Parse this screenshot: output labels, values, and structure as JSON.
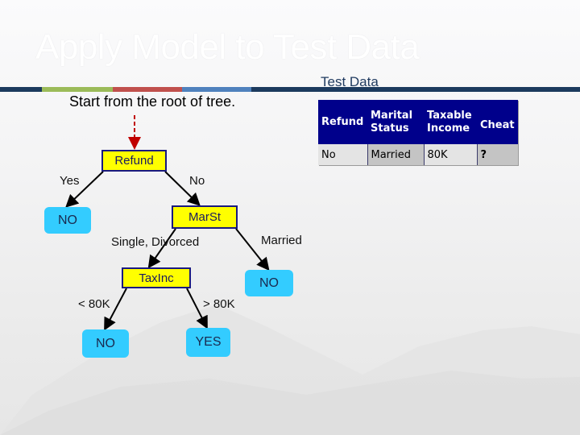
{
  "slide": {
    "title": "Apply Model to Test Data",
    "subtitle": "Start from the root of tree.",
    "accent_band_colors": [
      "#1c3a5e",
      "#9bbb59",
      "#c0504d",
      "#4f81bd",
      "#1c3a5e"
    ]
  },
  "test_data": {
    "label": "Test Data",
    "headers": [
      "Refund",
      "Marital Status",
      "Taxable Income",
      "Cheat"
    ],
    "header_lines": [
      [
        "Refund"
      ],
      [
        "Marital",
        "Status"
      ],
      [
        "Taxable",
        "Income"
      ],
      [
        "Cheat"
      ]
    ],
    "row": [
      "No",
      "Married",
      "80K",
      "?"
    ],
    "header_color": "#00008b"
  },
  "tree": {
    "root": {
      "label": "Refund"
    },
    "nodes": {
      "refund": "Refund",
      "marst": "MarSt",
      "taxinc": "TaxInc",
      "leaf_refund_yes": "NO",
      "leaf_married": "NO",
      "leaf_lt80": "NO",
      "leaf_gt80": "YES"
    },
    "edges": {
      "refund_yes": "Yes",
      "refund_no": "No",
      "marst_single_divorced": "Single, Divorced",
      "marst_married": "Married",
      "taxinc_lt": "< 80K",
      "taxinc_gt": "> 80K"
    },
    "colors": {
      "test_node_fill": "#ffff00",
      "test_node_border": "#1a1a80",
      "leaf_fill": "#33ccff",
      "start_arrow": "#c00000"
    }
  }
}
